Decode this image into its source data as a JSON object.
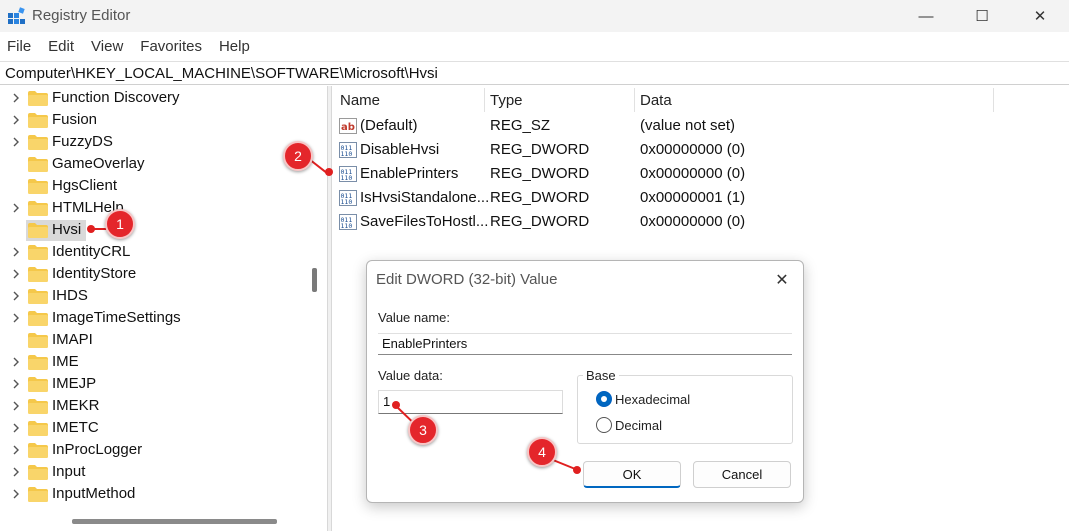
{
  "window": {
    "title": "Registry Editor",
    "minimize_glyph": "—",
    "maximize_glyph": "☐",
    "close_glyph": "✕"
  },
  "menu": [
    "File",
    "Edit",
    "View",
    "Favorites",
    "Help"
  ],
  "address": "Computer\\HKEY_LOCAL_MACHINE\\SOFTWARE\\Microsoft\\Hvsi",
  "tree": {
    "items": [
      {
        "label": "Function Discovery",
        "expandable": true
      },
      {
        "label": "Fusion",
        "expandable": true
      },
      {
        "label": "FuzzyDS",
        "expandable": true
      },
      {
        "label": "GameOverlay",
        "expandable": false
      },
      {
        "label": "HgsClient",
        "expandable": false
      },
      {
        "label": "HTMLHelp",
        "expandable": true
      },
      {
        "label": "Hvsi",
        "expandable": false,
        "selected": true
      },
      {
        "label": "IdentityCRL",
        "expandable": true
      },
      {
        "label": "IdentityStore",
        "expandable": true
      },
      {
        "label": "IHDS",
        "expandable": true
      },
      {
        "label": "ImageTimeSettings",
        "expandable": true
      },
      {
        "label": "IMAPI",
        "expandable": false
      },
      {
        "label": "IME",
        "expandable": true
      },
      {
        "label": "IMEJP",
        "expandable": true
      },
      {
        "label": "IMEKR",
        "expandable": true
      },
      {
        "label": "IMETC",
        "expandable": true
      },
      {
        "label": "InProcLogger",
        "expandable": true
      },
      {
        "label": "Input",
        "expandable": true
      },
      {
        "label": "InputMethod",
        "expandable": true
      }
    ]
  },
  "list": {
    "columns": [
      "Name",
      "Type",
      "Data"
    ],
    "rows": [
      {
        "name": "(Default)",
        "type": "REG_SZ",
        "data": "(value not set)",
        "icon": "string-value-icon"
      },
      {
        "name": "DisableHvsi",
        "type": "REG_DWORD",
        "data": "0x00000000 (0)",
        "icon": "dword-value-icon"
      },
      {
        "name": "EnablePrinters",
        "type": "REG_DWORD",
        "data": "0x00000000 (0)",
        "icon": "dword-value-icon"
      },
      {
        "name": "IsHvsiStandalone...",
        "type": "REG_DWORD",
        "data": "0x00000001 (1)",
        "icon": "dword-value-icon"
      },
      {
        "name": "SaveFilesToHostl...",
        "type": "REG_DWORD",
        "data": "0x00000000 (0)",
        "icon": "dword-value-icon"
      }
    ]
  },
  "dialog": {
    "title": "Edit DWORD (32-bit) Value",
    "close_glyph": "✕",
    "value_name_label": "Value name:",
    "value_name": "EnablePrinters",
    "value_data_label": "Value data:",
    "value_data": "1",
    "base_label": "Base",
    "base_options": [
      "Hexadecimal",
      "Decimal"
    ],
    "base_selected": "Hexadecimal",
    "ok_label": "OK",
    "cancel_label": "Cancel"
  },
  "callouts": [
    "1",
    "2",
    "3",
    "4"
  ],
  "colors": {
    "callout": "#e4262b",
    "accent": "#0067c0",
    "folder": "#f5c84a"
  }
}
